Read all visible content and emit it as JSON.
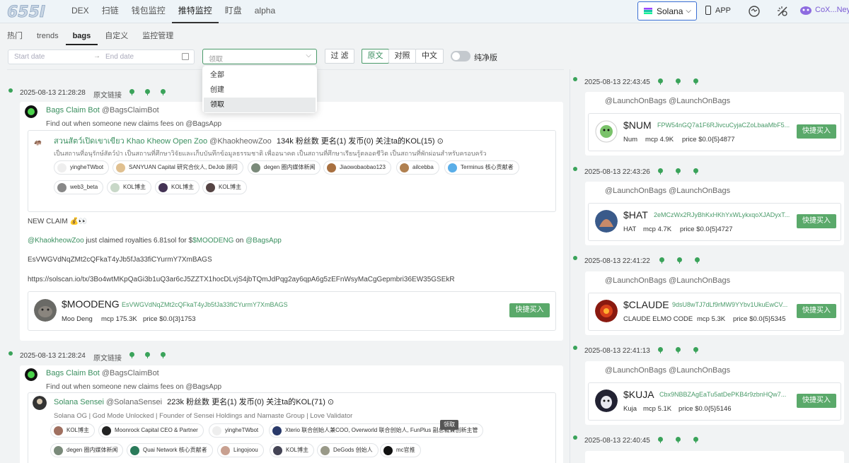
{
  "topbar": {
    "logo": "655I",
    "nav": [
      "DEX",
      "扫链",
      "钱包监控",
      "推特监控",
      "盯盘",
      "alpha"
    ],
    "nav_active": 3,
    "chain": "Solana",
    "app_label": "APP",
    "user": "CoX...Ney"
  },
  "subtabs": [
    "热门",
    "trends",
    "bags",
    "自定义",
    "监控管理"
  ],
  "subtab_active": 2,
  "filter": {
    "start_placeholder": "Start date",
    "end_placeholder": "End date",
    "select_placeholder": "领取",
    "filter_btn": "过 滤",
    "lang_options": [
      "原文",
      "对照",
      "中文"
    ],
    "toggle_label": "纯净版",
    "dropdown_options": [
      "全部",
      "创建",
      "领取"
    ],
    "dropdown_selected": 2,
    "tooltip": "领取"
  },
  "left_posts": [
    {
      "time": "2025-08-13 21:28:28",
      "link": "原文链接",
      "bot_name": "Bags Claim Bot",
      "bot_handle": "@BagsClaimBot",
      "bot_desc": "Find out when someone new claims fees on @BagsApp",
      "account_name": "สวนสัตว์เปิดเขาเขียว Khao Kheow Open Zoo",
      "account_handle": "@KhaokheowZoo",
      "account_stats": "134k 粉丝数 更名(1) 发币(0) 关注ta的KOL(15)",
      "account_bio": "เป็นสถานที่อนุรักษ์สัตว์ป่า เป็นสถานที่ศึกษาวิจัยและเก็บบันทึกข้อมูลธรรมชาติ เพื่ออนาคต เป็นสถานที่ศึกษาเรียนรู้ตลอดชีวิต เป็นสถานที่พักผ่อนสำหรับครอบครัว",
      "kol_row1": [
        "yingheTWbot",
        "SANYUAN Capital 研究合伙人, DeJob 顾问",
        "degen 圈内媒体新闻",
        "Jiaowobaobao123",
        "ailcebba",
        "Terminus 核心贡献者"
      ],
      "kol_row2": [
        "web3_beta",
        "KOL博主",
        "KOL博主",
        "KOL博主"
      ],
      "claim_title": "NEW CLAIM 💰👀",
      "claim_user": "@KhaokheowZoo",
      "claim_mid": " just claimed royalties 6.81sol for $",
      "claim_token": "$MOODENG",
      "claim_on": " on ",
      "claim_app": "@BagsApp",
      "claim_ca": "EsVWGVdNqZMt2cQFkaT4yJb5fJa33fiCYurmY7XmBAGS",
      "claim_tx": "https://solscan.io/tx/3Bo4wtMKpQaGi3b1uQ3ar6cJ5ZZTX1hocDLvjS4jbTQmJdPqg2ay6qpA6g5zEFnWsyMaCgGepmbri36EW35GSEkR",
      "token_symbol": "$MOODENG",
      "token_ca": "EsVWGVdNqZMt2cQFkaT4yJb5fJa33fiCYurmY7XmBAGS",
      "token_name": "Moo Deng",
      "token_mcp": "mcp 175.3K",
      "token_price": "price $0.0{3}1753",
      "buy": "快捷买入"
    },
    {
      "time": "2025-08-13 21:28:24",
      "link": "原文链接",
      "bot_name": "Bags Claim Bot",
      "bot_handle": "@BagsClaimBot",
      "bot_desc": "Find out when someone new claims fees on @BagsApp",
      "account_name": "Solana Sensei",
      "account_handle": "@SolanaSensei",
      "account_stats": "223k 粉丝数 更名(1) 发币(0) 关注ta的KOL(71)",
      "account_bio": "Solana OG | God Mode Unlocked | Founder of Sensei Holdings and Namaste Group | Love Validator",
      "kol_row1": [
        "KOL博主",
        "Moonrock Capital CEO & Partner",
        "yingheTWbot",
        "Xterio 联合创始人兼COO, Overworld 联合创始人, FunPlus 副总裁兼创新主管"
      ],
      "kol_row2": [
        "degen 圈内媒体新闻",
        "Quai Network 核心贡献者",
        "Lingojoou",
        "KOL博主",
        "DeGods 创始人",
        "mc官推"
      ]
    }
  ],
  "right_posts": [
    {
      "time": "2025-08-13 22:43:45",
      "account": "@LaunchOnBags",
      "handle": "@LaunchOnBags",
      "symbol": "$NUM",
      "ca": "FPW54nGQ7a1F6RJivcuCyjaCZoLbaaMbF5...",
      "name": "Num",
      "mcp": "mcp 4.9K",
      "price": "price $0.0{5}4877",
      "buy": "快捷买入"
    },
    {
      "time": "2025-08-13 22:43:26",
      "account": "@LaunchOnBags",
      "handle": "@LaunchOnBags",
      "symbol": "$HAT",
      "ca": "2eMCzWx2RJyBhKxHKhYxWLykxqoXJADyxT...",
      "name": "HAT",
      "mcp": "mcp 4.7K",
      "price": "price $0.0{5}4727",
      "buy": "快捷买入"
    },
    {
      "time": "2025-08-13 22:41:22",
      "account": "@LaunchOnBags",
      "handle": "@LaunchOnBags",
      "symbol": "$CLAUDE",
      "ca": "9dsU8wTJ7dLf9rMW9YYbv1UkuEwCV...",
      "name": "CLAUDE ELMO CODE",
      "mcp": "mcp 5.3K",
      "price": "price $0.0{5}5345",
      "buy": "快捷买入"
    },
    {
      "time": "2025-08-13 22:41:13",
      "account": "@LaunchOnBags",
      "handle": "@LaunchOnBags",
      "symbol": "$KUJA",
      "ca": "Cbx9NBBZAgEaTu5atDePKB4r9zbnHQw7...",
      "name": "Kuja",
      "mcp": "mcp 5.1K",
      "price": "price $0.0{5}5146",
      "buy": "快捷买入"
    },
    {
      "time": "2025-08-13 22:40:45"
    }
  ]
}
